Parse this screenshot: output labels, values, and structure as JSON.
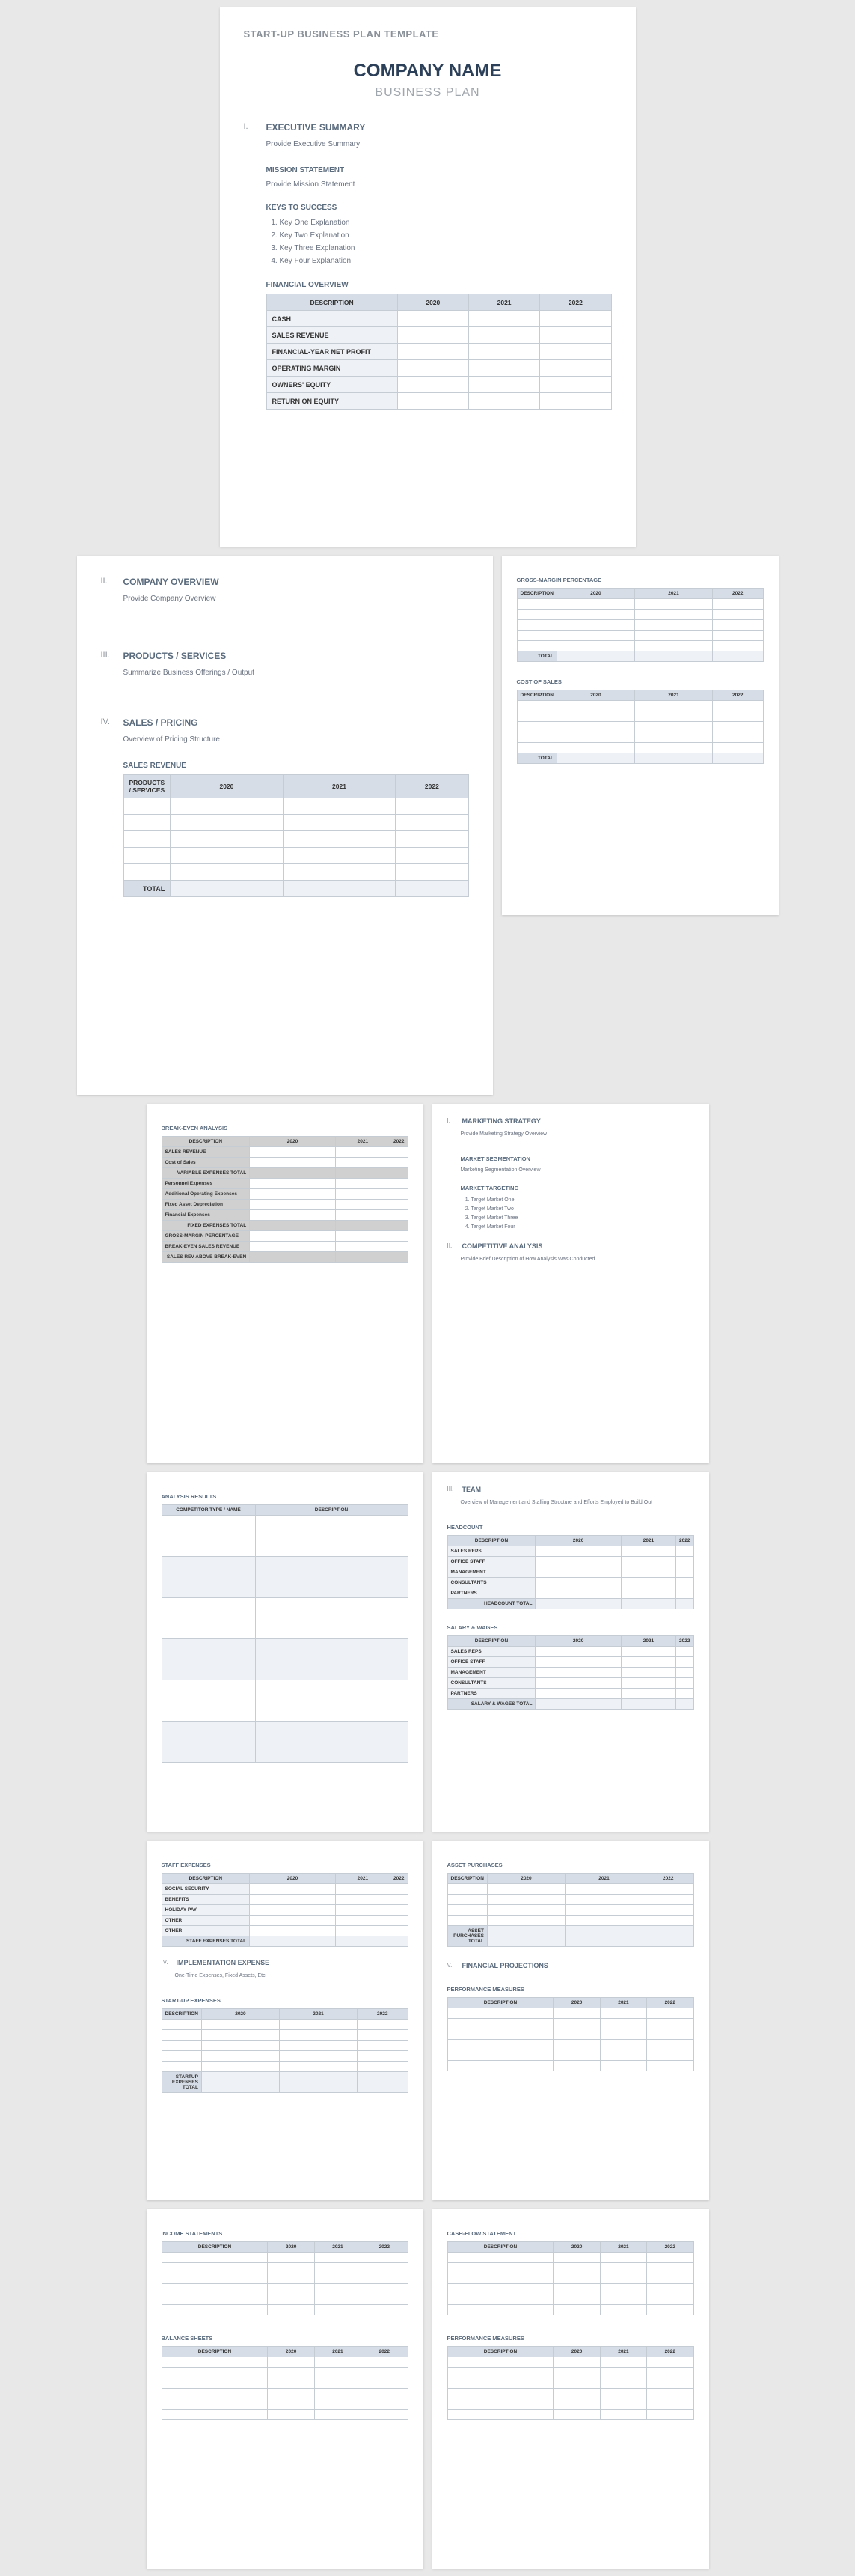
{
  "doc_title": "START-UP BUSINESS PLAN TEMPLATE",
  "company": "COMPANY NAME",
  "subtitle": "BUSINESS PLAN",
  "years": [
    "2020",
    "2021",
    "2022"
  ],
  "s1": {
    "num": "I.",
    "title": "EXECUTIVE SUMMARY",
    "body": "Provide Executive Summary"
  },
  "mission": {
    "title": "MISSION STATEMENT",
    "body": "Provide Mission Statement"
  },
  "keys": {
    "title": "KEYS TO SUCCESS",
    "items": [
      "Key One Explanation",
      "Key Two Explanation",
      "Key Three Explanation",
      "Key Four Explanation"
    ]
  },
  "fin": {
    "title": "FINANCIAL OVERVIEW",
    "desc": "DESCRIPTION",
    "rows": [
      "CASH",
      "SALES REVENUE",
      "FINANCIAL-YEAR NET PROFIT",
      "OPERATING MARGIN",
      "OWNERS' EQUITY",
      "RETURN ON EQUITY"
    ]
  },
  "s2": {
    "num": "II.",
    "title": "COMPANY OVERVIEW",
    "body": "Provide Company Overview"
  },
  "s3": {
    "num": "III.",
    "title": "PRODUCTS / SERVICES",
    "body": "Summarize Business Offerings / Output"
  },
  "s4": {
    "num": "IV.",
    "title": "SALES / PRICING",
    "body": "Overview of Pricing Structure"
  },
  "salesrev": {
    "title": "SALES REVENUE",
    "col": "PRODUCTS / SERVICES",
    "total": "TOTAL"
  },
  "gross": {
    "title": "GROSS-MARGIN PERCENTAGE",
    "desc": "DESCRIPTION",
    "total": "TOTAL"
  },
  "cost": {
    "title": "COST OF SALES",
    "desc": "DESCRIPTION",
    "total": "TOTAL"
  },
  "break": {
    "title": "BREAK-EVEN ANALYSIS",
    "desc": "DESCRIPTION",
    "rows": [
      "SALES REVENUE",
      "Cost of Sales"
    ],
    "vartot": "VARIABLE EXPENSES TOTAL",
    "rows2": [
      "Personnel Expenses",
      "Additional Operating Expenses",
      "Fixed Asset Depreciation",
      "Financial Expenses"
    ],
    "fixtot": "FIXED EXPENSES TOTAL",
    "rows3": [
      "GROSS-MARGIN PERCENTAGE",
      "BREAK-EVEN SALES REVENUE"
    ],
    "bot": "SALES REV ABOVE BREAK-EVEN"
  },
  "mkt": {
    "num": "I.",
    "title": "MARKETING STRATEGY",
    "body": "Provide Marketing Strategy Overview"
  },
  "seg": {
    "title": "MARKET SEGMENTATION",
    "body": "Marketing Segmentation Overview"
  },
  "tgt": {
    "title": "MARKET TARGETING",
    "items": [
      "Target Market One",
      "Target Market Two",
      "Target Market Three",
      "Target Market Four"
    ]
  },
  "comp": {
    "num": "II.",
    "title": "COMPETITIVE ANALYSIS",
    "body": "Provide Brief Description of How Analysis Was Conducted"
  },
  "anres": {
    "title": "ANALYSIS RESULTS",
    "col1": "COMPETITOR TYPE / NAME",
    "col2": "DESCRIPTION"
  },
  "team": {
    "num": "III.",
    "title": "TEAM",
    "body": "Overview of Management and Staffing Structure and Efforts Employed to Build Out"
  },
  "head": {
    "title": "HEADCOUNT",
    "desc": "DESCRIPTION",
    "rows": [
      "SALES REPS",
      "OFFICE STAFF",
      "MANAGEMENT",
      "CONSULTANTS",
      "PARTNERS"
    ],
    "total": "HEADCOUNT TOTAL"
  },
  "salary": {
    "title": "SALARY & WAGES",
    "desc": "DESCRIPTION",
    "rows": [
      "SALES REPS",
      "OFFICE STAFF",
      "MANAGEMENT",
      "CONSULTANTS",
      "PARTNERS"
    ],
    "total": "SALARY & WAGES TOTAL"
  },
  "staff": {
    "title": "STAFF EXPENSES",
    "desc": "DESCRIPTION",
    "rows": [
      "SOCIAL SECURITY",
      "BENEFITS",
      "HOLIDAY PAY",
      "OTHER",
      "OTHER"
    ],
    "total": "STAFF EXPENSES TOTAL"
  },
  "impl": {
    "num": "IV.",
    "title": "IMPLEMENTATION EXPENSE",
    "body": "One-Time Expenses, Fixed Assets, Etc."
  },
  "startup": {
    "title": "START-UP EXPENSES",
    "desc": "DESCRIPTION",
    "total": "STARTUP EXPENSES TOTAL"
  },
  "asset": {
    "title": "ASSET PURCHASES",
    "desc": "DESCRIPTION",
    "total": "ASSET PURCHASES TOTAL"
  },
  "proj": {
    "num": "V.",
    "title": "FINANCIAL PROJECTIONS"
  },
  "perf": {
    "title": "PERFORMANCE MEASURES",
    "desc": "DESCRIPTION"
  },
  "inc": {
    "title": "INCOME STATEMENTS",
    "desc": "DESCRIPTION"
  },
  "bal": {
    "title": "BALANCE SHEETS",
    "desc": "DESCRIPTION"
  },
  "cash": {
    "title": "CASH-FLOW STATEMENT",
    "desc": "DESCRIPTION"
  },
  "perf2": {
    "title": "PERFORMANCE MEASURES",
    "desc": "DESCRIPTION"
  }
}
